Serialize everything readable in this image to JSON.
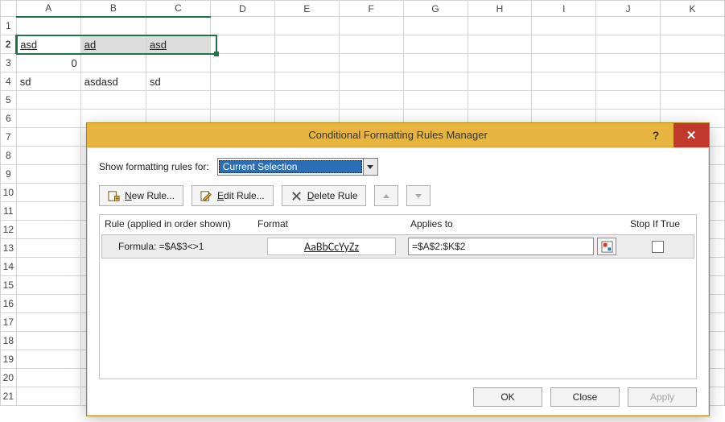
{
  "sheet": {
    "columns": [
      "A",
      "B",
      "C",
      "D",
      "E",
      "F",
      "G",
      "H",
      "I",
      "J",
      "K"
    ],
    "rows": [
      "1",
      "2",
      "3",
      "4",
      "5",
      "6",
      "7",
      "8",
      "9",
      "10",
      "11",
      "12",
      "13",
      "14",
      "15",
      "16",
      "17",
      "18",
      "19",
      "20",
      "21"
    ],
    "cells": {
      "A2": "asd",
      "B2": "ad",
      "C2": "asd",
      "A3": "0",
      "A4": "sd",
      "B4": "asdasd",
      "C4": "sd"
    }
  },
  "dialog": {
    "title": "Conditional Formatting Rules Manager",
    "show_for_label": "Show formatting rules for:",
    "show_for_value": "Current Selection",
    "buttons": {
      "new": "New Rule...",
      "edit": "Edit Rule...",
      "delete": "Delete Rule"
    },
    "headers": {
      "rule": "Rule (applied in order shown)",
      "format": "Format",
      "applies": "Applies to",
      "stop": "Stop If True"
    },
    "rule1": {
      "desc": "Formula: =$A$3<>1",
      "preview": "AaBbCcYyZz",
      "applies": "=$A$2:$K$2"
    },
    "footer": {
      "ok": "OK",
      "close": "Close",
      "apply": "Apply"
    }
  }
}
